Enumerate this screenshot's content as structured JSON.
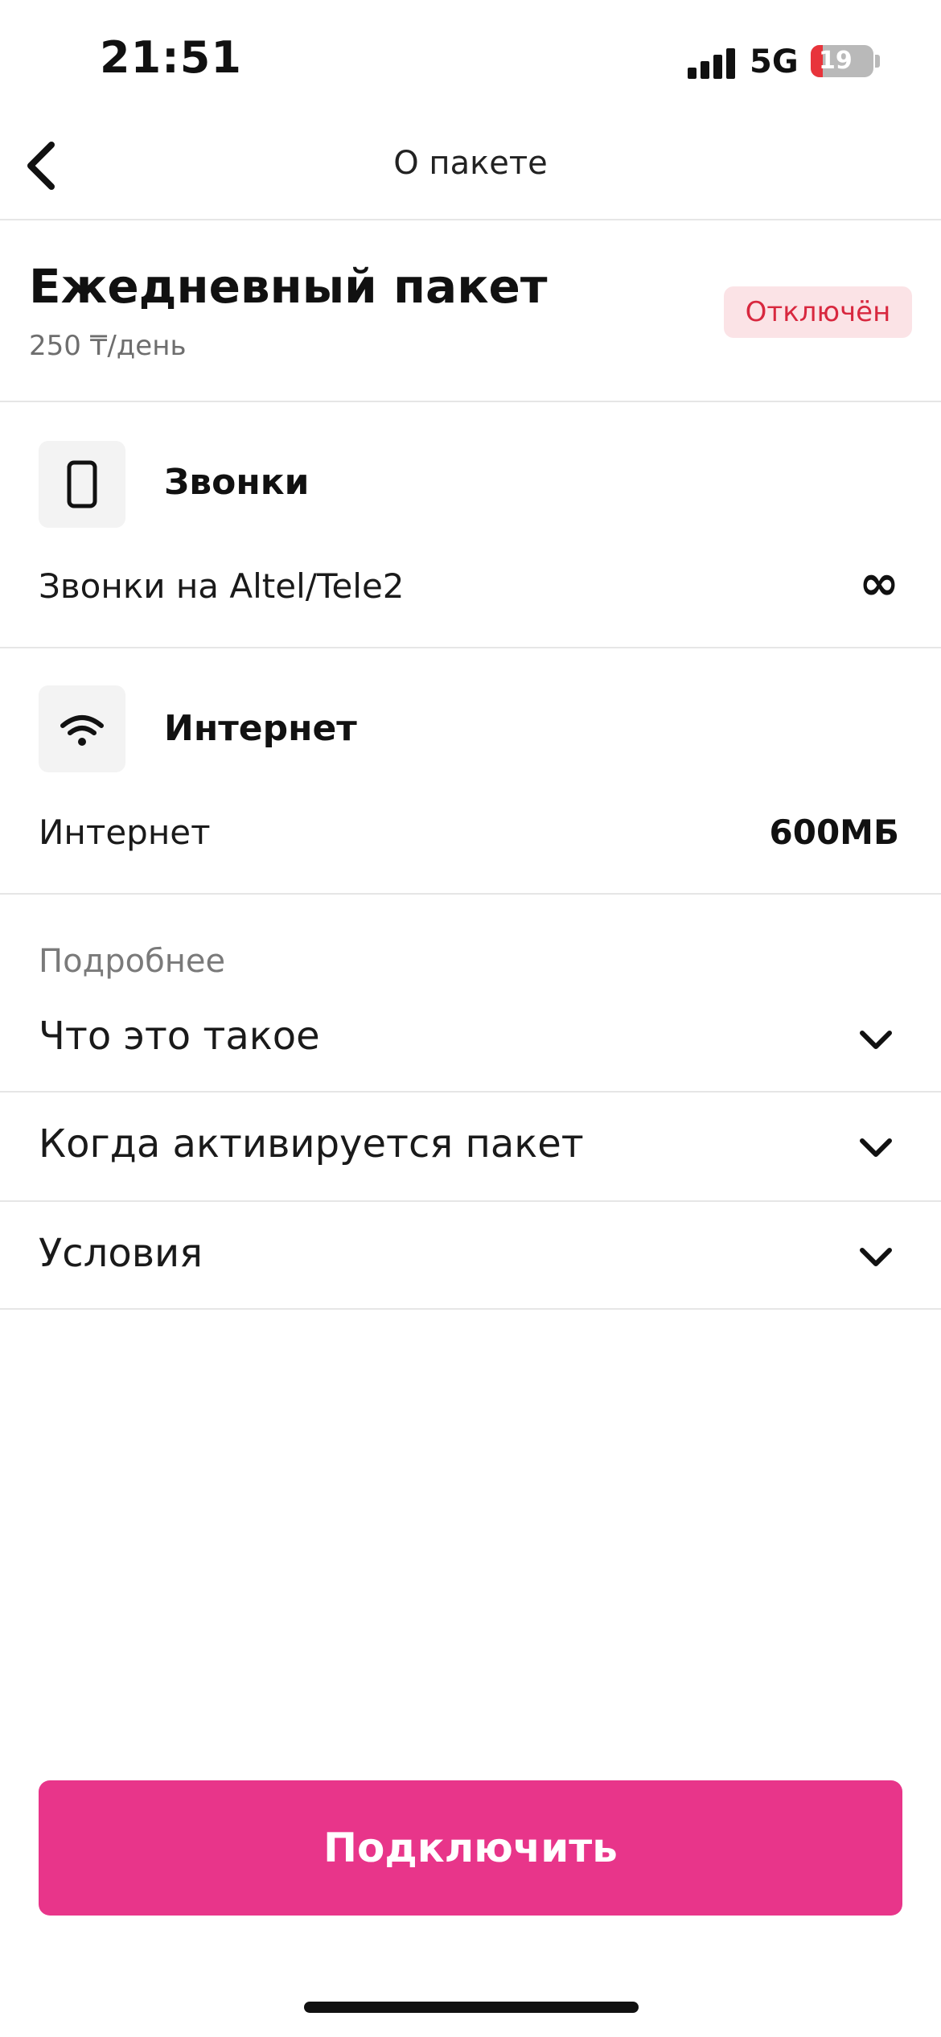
{
  "status_bar": {
    "time": "21:51",
    "network": "5G",
    "battery": "19",
    "battery_level": 0.19
  },
  "nav": {
    "title": "О пакете"
  },
  "package": {
    "title": "Ежедневный пакет",
    "price": "250 ₸/день",
    "status": "Отключён"
  },
  "calls": {
    "heading": "Звонки",
    "row_label": "Звонки на Altel/Tele2",
    "row_value": "∞"
  },
  "internet": {
    "heading": "Интернет",
    "row_label": "Интернет",
    "row_value": "600МБ"
  },
  "details": {
    "label": "Подробнее",
    "items": [
      {
        "label": "Что это такое"
      },
      {
        "label": "Когда активируется пакет"
      },
      {
        "label": "Условия"
      }
    ]
  },
  "action": {
    "connect_label": "Подключить"
  },
  "colors": {
    "accent": "#e8358a",
    "status_badge_bg": "#fbe3e6",
    "status_badge_text": "#d8283f"
  }
}
